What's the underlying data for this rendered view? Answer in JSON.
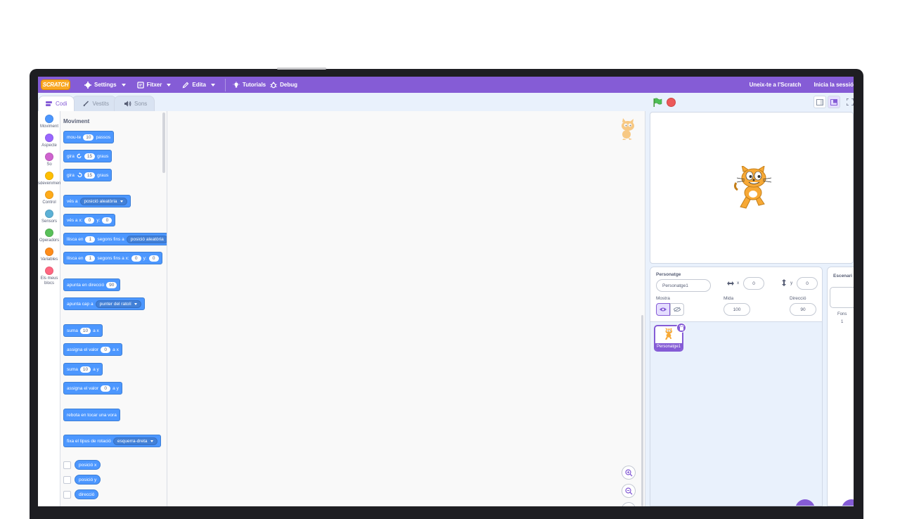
{
  "menu": {
    "logo": "SCRATCH",
    "settings": "Settings",
    "file": "Fitxer",
    "edit": "Edita",
    "tutorials": "Tutorials",
    "debug": "Debug",
    "join": "Uneix-te a l'Scratch",
    "signin": "Inicia la sessió"
  },
  "tabs": {
    "code": "Codi",
    "costumes": "Vestits",
    "sounds": "Sons"
  },
  "categories": [
    {
      "label": "Moviment",
      "color": "#4c97ff"
    },
    {
      "label": "Aspecte",
      "color": "#9966ff"
    },
    {
      "label": "So",
      "color": "#cf63cf"
    },
    {
      "label": "Esdeveniments",
      "color": "#ffbf00"
    },
    {
      "label": "Control",
      "color": "#ffab19"
    },
    {
      "label": "Sensors",
      "color": "#5cb1d6"
    },
    {
      "label": "Operadors",
      "color": "#59c059"
    },
    {
      "label": "Variables",
      "color": "#ff8c1a"
    },
    {
      "label": "Els meus blocs",
      "color": "#ff6680"
    }
  ],
  "palette": {
    "title": "Moviment",
    "move": {
      "a": "mou-te",
      "val": "10",
      "b": "passos"
    },
    "turn_right": {
      "a": "gira",
      "val": "15",
      "b": "graus"
    },
    "turn_left": {
      "a": "gira",
      "val": "15",
      "b": "graus"
    },
    "goto": {
      "a": "vés a",
      "dd": "posició aleatòria"
    },
    "goto_xy": {
      "a": "vés a x:",
      "x": "0",
      "b": "y:",
      "y": "0"
    },
    "glide": {
      "a": "llisca en",
      "val": "1",
      "b": "segons fins a",
      "dd": "posició aleatòria"
    },
    "glide_xy": {
      "a": "llisca en",
      "val": "1",
      "b": "segons fins a x:",
      "x": "0",
      "c": "y:",
      "y": "0"
    },
    "point_dir": {
      "a": "apunta en direcció",
      "val": "90"
    },
    "point_towards": {
      "a": "apunta cap a",
      "dd": "punter del ratolí"
    },
    "change_x": {
      "a": "suma",
      "val": "10",
      "b": "a x"
    },
    "set_x": {
      "a": "assigna el valor",
      "val": "0",
      "b": "a x"
    },
    "change_y": {
      "a": "suma",
      "val": "10",
      "b": "a y"
    },
    "set_y": {
      "a": "assigna el valor",
      "val": "0",
      "b": "a y"
    },
    "bounce": {
      "a": "rebota en tocar una vora"
    },
    "rotation": {
      "a": "fixa el tipus de rotació",
      "dd": "esquerra-dreta"
    },
    "rep_x": "posició x",
    "rep_y": "posició y",
    "rep_dir": "direcció"
  },
  "sprite_info": {
    "label": "Personatge",
    "name": "Personatge1",
    "x_label": "x",
    "x": "0",
    "y_label": "y",
    "y": "0",
    "show_label": "Mostra",
    "size_label": "Mida",
    "size": "100",
    "direction_label": "Direcció",
    "direction": "90"
  },
  "sprites": [
    {
      "name": "Personatge1"
    }
  ],
  "stage_pane": {
    "title": "Escenari",
    "backdrops_label": "Fons",
    "backdrops_count": "1"
  },
  "colors": {
    "accent": "#855cd6",
    "motion": "#4c97ff"
  }
}
